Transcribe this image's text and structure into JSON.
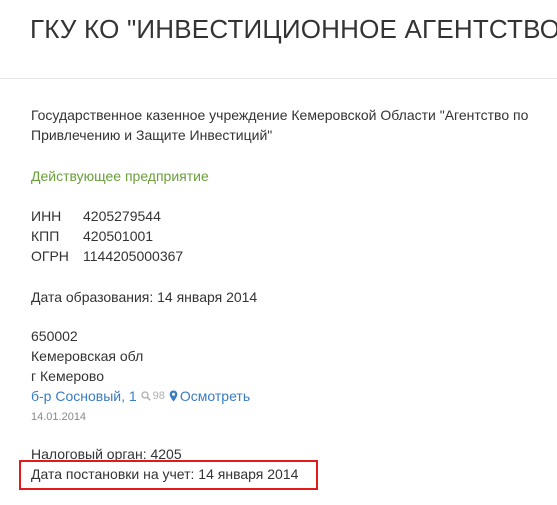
{
  "header": {
    "title": "ГКУ КО \"ИНВЕСТИЦИОННОЕ АГЕНТСТВО\""
  },
  "company": {
    "full_name": "Государственное казенное учреждение Кемеровской Области \"Агентство по Привлечению и Защите Инвестиций\"",
    "status": "Действующее предприятие",
    "status_color": "#6a9f3a"
  },
  "codes": [
    {
      "label": "ИНН",
      "value": "4205279544"
    },
    {
      "label": "КПП",
      "value": "420501001"
    },
    {
      "label": "ОГРН",
      "value": "1144205000367"
    }
  ],
  "registration": {
    "date_text": "Дата образования: 14 января 2014"
  },
  "address": {
    "postcode": "650002",
    "region": "Кемеровская обл",
    "city": "г Кемерово",
    "street": "б-р Сосновый, 1",
    "views_count": "98",
    "views_icon": "search-icon",
    "map_label": "Осмотреть",
    "map_icon": "map-marker-icon",
    "date": "14.01.2014",
    "link_color": "#3a7cc0"
  },
  "tax": {
    "authority": "Налоговый орган: 4205",
    "registered": "Дата постановки на учет: 14 января 2014",
    "highlight_color": "#e21a1a"
  }
}
